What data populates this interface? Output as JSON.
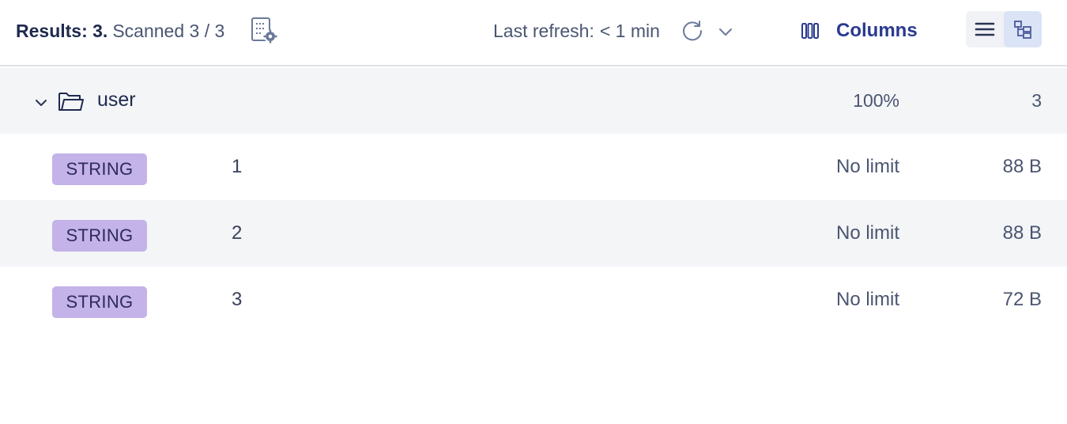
{
  "toolbar": {
    "results_label": "Results: 3.",
    "scanned_label": "Scanned 3 / 3",
    "last_refresh_label": "Last refresh:",
    "last_refresh_value": "< 1 min",
    "columns_label": "Columns",
    "icons": {
      "scan_settings": "scan-settings-icon",
      "refresh": "refresh-icon",
      "refresh_dropdown": "chevron-down-icon",
      "columns": "columns-icon",
      "list_view": "list-view-icon",
      "tree_view": "tree-view-icon"
    },
    "active_view": "tree"
  },
  "group": {
    "name": "user",
    "percent": "100%",
    "count": "3",
    "expanded": true
  },
  "rows": [
    {
      "type": "STRING",
      "key": "1",
      "ttl": "No limit",
      "size": "88 B"
    },
    {
      "type": "STRING",
      "key": "2",
      "ttl": "No limit",
      "size": "88 B"
    },
    {
      "type": "STRING",
      "key": "3",
      "ttl": "No limit",
      "size": "72 B"
    }
  ],
  "colors": {
    "accent": "#2b3a8f",
    "badge_string": "#c3b3e8",
    "row_alt": "#f4f5f7",
    "active_toggle": "#dbe3f7"
  }
}
